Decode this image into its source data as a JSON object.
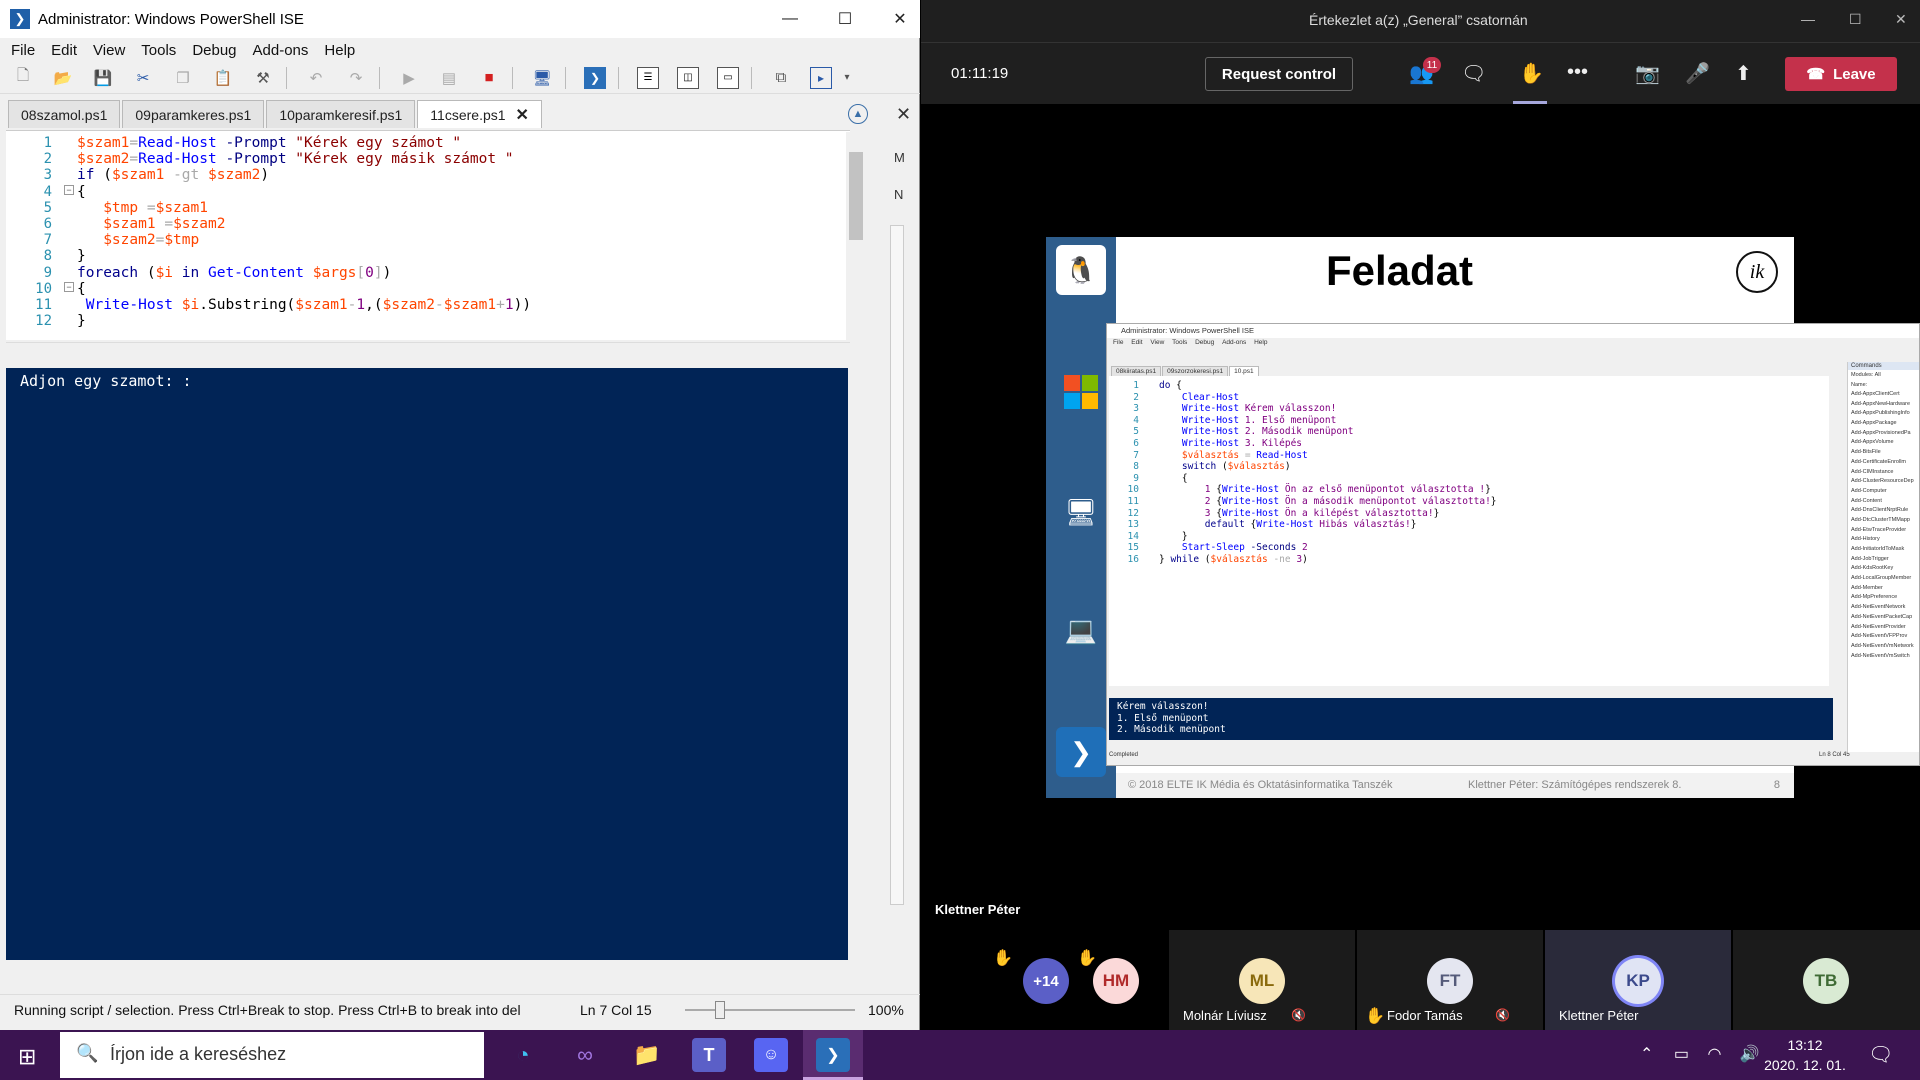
{
  "ise": {
    "title": "Administrator: Windows PowerShell ISE",
    "menu": [
      "File",
      "Edit",
      "View",
      "Tools",
      "Debug",
      "Add-ons",
      "Help"
    ],
    "tabs": [
      "08szamol.ps1",
      "09paramkeres.ps1",
      "10paramkeresif.ps1",
      "11csere.ps1"
    ],
    "side_labels": [
      "M",
      "N"
    ],
    "line_numbers": [
      "1",
      "2",
      "3",
      "4",
      "5",
      "6",
      "7",
      "8",
      "9",
      "10",
      "11",
      "12"
    ],
    "console_text": "Adjon egy szamot: :",
    "status": {
      "message": "Running script / selection.  Press Ctrl+Break to stop.  Press Ctrl+B to break into del",
      "position": "Ln 7  Col 15",
      "zoom": "100%"
    }
  },
  "teams": {
    "title": "Értekezlet a(z) „General” csatornán",
    "timer": "01:11:19",
    "request_control": "Request control",
    "badge": "11",
    "leave": "Leave",
    "presenter": "Klettner Péter",
    "participants": [
      {
        "initials": "+14",
        "name": ""
      },
      {
        "initials": "HM",
        "name": ""
      },
      {
        "initials": "ML",
        "name": "Molnár Líviusz"
      },
      {
        "initials": "FT",
        "name": "Fodor Tamás"
      },
      {
        "initials": "KP",
        "name": "Klettner Péter"
      },
      {
        "initials": "TB",
        "name": ""
      }
    ]
  },
  "slide": {
    "title": "Feladat",
    "logo": "ik",
    "footer_left": "© 2018 ELTE IK Média és Oktatásinformatika Tanszék",
    "footer_middle": "Klettner Péter: Számítógépes rendszerek 8.",
    "footer_page": "8",
    "inner": {
      "title": "Administrator: Windows PowerShell ISE",
      "menu": [
        "File",
        "Edit",
        "View",
        "Tools",
        "Debug",
        "Add-ons",
        "Help"
      ],
      "tabs": [
        "08kiiratas.ps1",
        "09szorzokeresi.ps1",
        "10.ps1"
      ],
      "line_numbers": [
        "1",
        "2",
        "3",
        "4",
        "5",
        "6",
        "7",
        "8",
        "9",
        "10",
        "11",
        "12",
        "13",
        "14",
        "15",
        "16"
      ],
      "console": [
        "Kérem válasszon!",
        "1. Első menüpont",
        "2. Második menüpont"
      ],
      "status_left": "Completed",
      "status_right": "Ln 8  Col 45",
      "commands_header": "Commands",
      "modules_label": "Modules:",
      "modules_value": "All",
      "name_label": "Name:",
      "command_list": [
        "Add-AppxClientCert",
        "Add-AppxNewHardware",
        "Add-AppxPublishingInfo",
        "Add-AppxPackage",
        "Add-AppxProvisionedPa",
        "Add-AppxVolume",
        "Add-BitsFile",
        "Add-CertificateEnrollm",
        "Add-CIMInstance",
        "Add-ClusterResourceDep",
        "Add-Computer",
        "Add-Content",
        "Add-DnsClientNrptRule",
        "Add-DtcClusterTMMapp",
        "Add-EtwTraceProvider",
        "Add-History",
        "Add-InitiatorIdToMask",
        "Add-JobTrigger",
        "Add-KdsRootKey",
        "Add-LocalGroupMember",
        "Add-Member",
        "Add-MpPreference",
        "Add-NetEventNetwork",
        "Add-NetEventPacketCap",
        "Add-NetEventProvider",
        "Add-NetEventVFPProv",
        "Add-NetEventVmNetwork",
        "Add-NetEventVmSwitch"
      ]
    }
  }
}
